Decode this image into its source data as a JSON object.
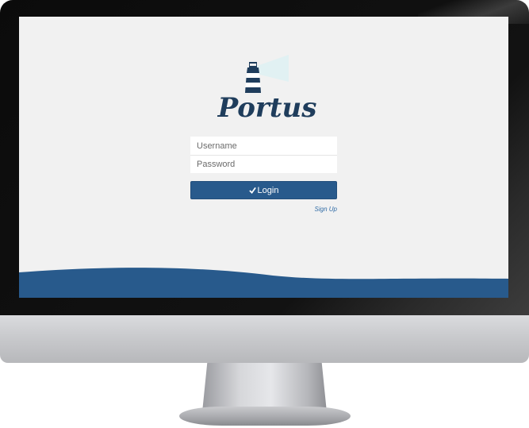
{
  "app": {
    "logo_text": "Portus"
  },
  "login": {
    "username_placeholder": "Username",
    "password_placeholder": "Password",
    "submit_label": "Login",
    "signup_label": "Sign Up"
  },
  "icons": {
    "logo": "lighthouse-logo-icon",
    "submit": "check-icon"
  },
  "colors": {
    "brand": "#285a8c",
    "logo_text": "#1f3d5c",
    "screen_bg": "#f1f1f1",
    "link": "#2e6aa5"
  }
}
